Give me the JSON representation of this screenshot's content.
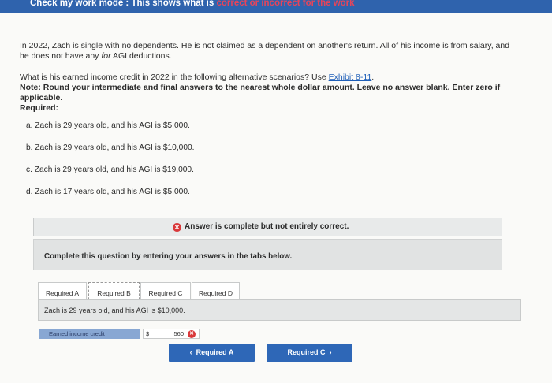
{
  "header": {
    "prefix": "Check my work mode : This shows what is ",
    "highlight": "correct or incorrect for the work"
  },
  "question": {
    "line1": "In 2022, Zach is single with no dependents. He is not claimed as a dependent on another's return. All of his income is from salary, and",
    "line2_a": "he does not have any ",
    "line2_italic": "for",
    "line2_b": " AGI deductions.",
    "ask": "What is his earned income credit in 2022 in the following alternative scenarios? Use ",
    "ask_link": "Exhibit 8-11",
    "ask_end": ".",
    "note1": "Note: Round your intermediate and final answers to the nearest whole dollar amount. Leave no answer blank. Enter zero if",
    "note2": "applicable.",
    "required": "Required:"
  },
  "scenarios": [
    "a. Zach is 29 years old, and his AGI is $5,000.",
    "b. Zach is 29 years old, and his AGI is $10,000.",
    "c. Zach is 29 years old, and his AGI is $19,000.",
    "d. Zach is 17 years old, and his AGI is $5,000."
  ],
  "status": {
    "icon": "x-circle-icon",
    "text": "Answer is complete but not entirely correct."
  },
  "instructions": "Complete this question by entering your answers in the tabs below.",
  "tabs": [
    "Required A",
    "Required B",
    "Required C",
    "Required D"
  ],
  "active_tab": "Required B",
  "panel": {
    "prompt": "Zach is 29 years old, and his AGI is $10,000.",
    "row_label": "Earned income credit",
    "currency": "$",
    "value": "560"
  },
  "nav": {
    "prev": "Required A",
    "next": "Required C"
  },
  "colors": {
    "header_bg": "#2f63ad",
    "incorrect": "#d9383a",
    "button_bg": "#2e67b7",
    "label_bg": "#88a7d3"
  }
}
